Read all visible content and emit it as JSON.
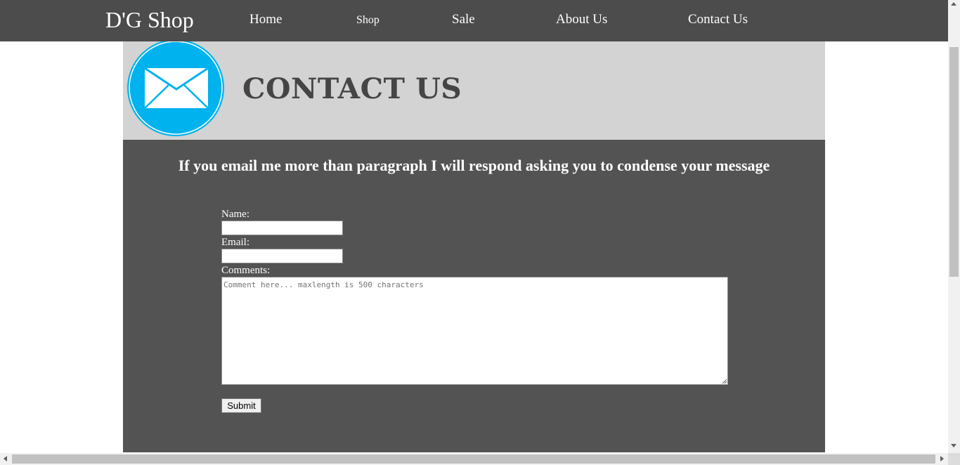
{
  "nav": {
    "brand": "D'G Shop",
    "links": [
      "Home",
      "Shop",
      "Sale",
      "About Us",
      "Contact Us"
    ]
  },
  "header": {
    "icon": "envelope-icon",
    "title": "CONTACT US",
    "icon_color": "#00b2ee"
  },
  "main": {
    "notice": "If you email me more than paragraph I will respond asking you to condense your message"
  },
  "form": {
    "name_label": "Name:",
    "name_value": "",
    "email_label": "Email:",
    "email_value": "",
    "comments_label": "Comments:",
    "comments_placeholder": "Comment here... maxlength is 500 characters",
    "submit_label": "Submit"
  },
  "colors": {
    "nav_bg": "#4c4c4c",
    "header_bg": "#d3d3d3",
    "content_bg": "#535353"
  }
}
